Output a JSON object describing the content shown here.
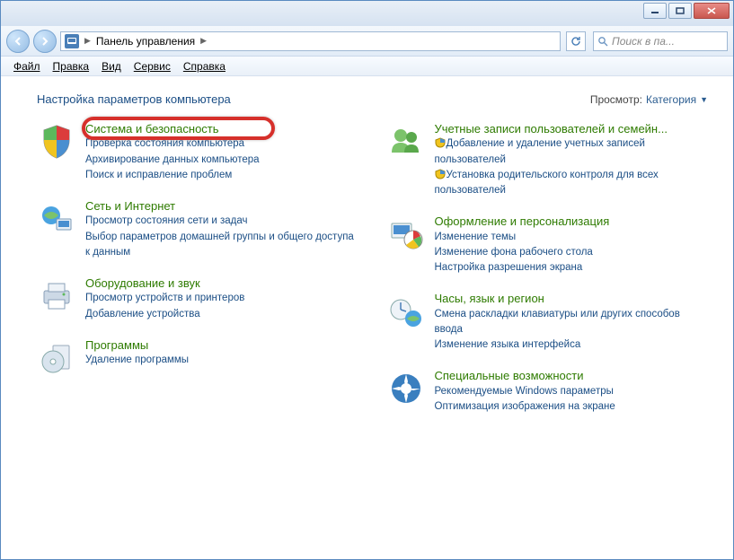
{
  "window": {
    "title": "Панель управления"
  },
  "nav": {
    "breadcrumb": "Панель управления",
    "search_placeholder": "Поиск в па..."
  },
  "menu": {
    "file": "Файл",
    "edit": "Правка",
    "view": "Вид",
    "tools": "Сервис",
    "help": "Справка"
  },
  "header": {
    "title": "Настройка параметров компьютера",
    "view_label": "Просмотр:",
    "view_value": "Категория"
  },
  "left": [
    {
      "title": "Система и безопасность",
      "highlighted": true,
      "subs": [
        "Проверка состояния компьютера",
        "Архивирование данных компьютера",
        "Поиск и исправление проблем"
      ]
    },
    {
      "title": "Сеть и Интернет",
      "subs": [
        "Просмотр состояния сети и задач",
        "Выбор параметров домашней группы и общего доступа к данным"
      ]
    },
    {
      "title": "Оборудование и звук",
      "subs": [
        "Просмотр устройств и принтеров",
        "Добавление устройства"
      ]
    },
    {
      "title": "Программы",
      "subs": [
        "Удаление программы"
      ]
    }
  ],
  "right": [
    {
      "title": "Учетные записи пользователей и семейн...",
      "subs_shield": [
        "Добавление и удаление учетных записей пользователей",
        "Установка родительского контроля для всех пользователей"
      ]
    },
    {
      "title": "Оформление и персонализация",
      "subs": [
        "Изменение темы",
        "Изменение фона рабочего стола",
        "Настройка разрешения экрана"
      ]
    },
    {
      "title": "Часы, язык и регион",
      "subs": [
        "Смена раскладки клавиатуры или других способов ввода",
        "Изменение языка интерфейса"
      ]
    },
    {
      "title": "Специальные возможности",
      "subs": [
        "Рекомендуемые Windows параметры",
        "Оптимизация изображения на экране"
      ]
    }
  ]
}
